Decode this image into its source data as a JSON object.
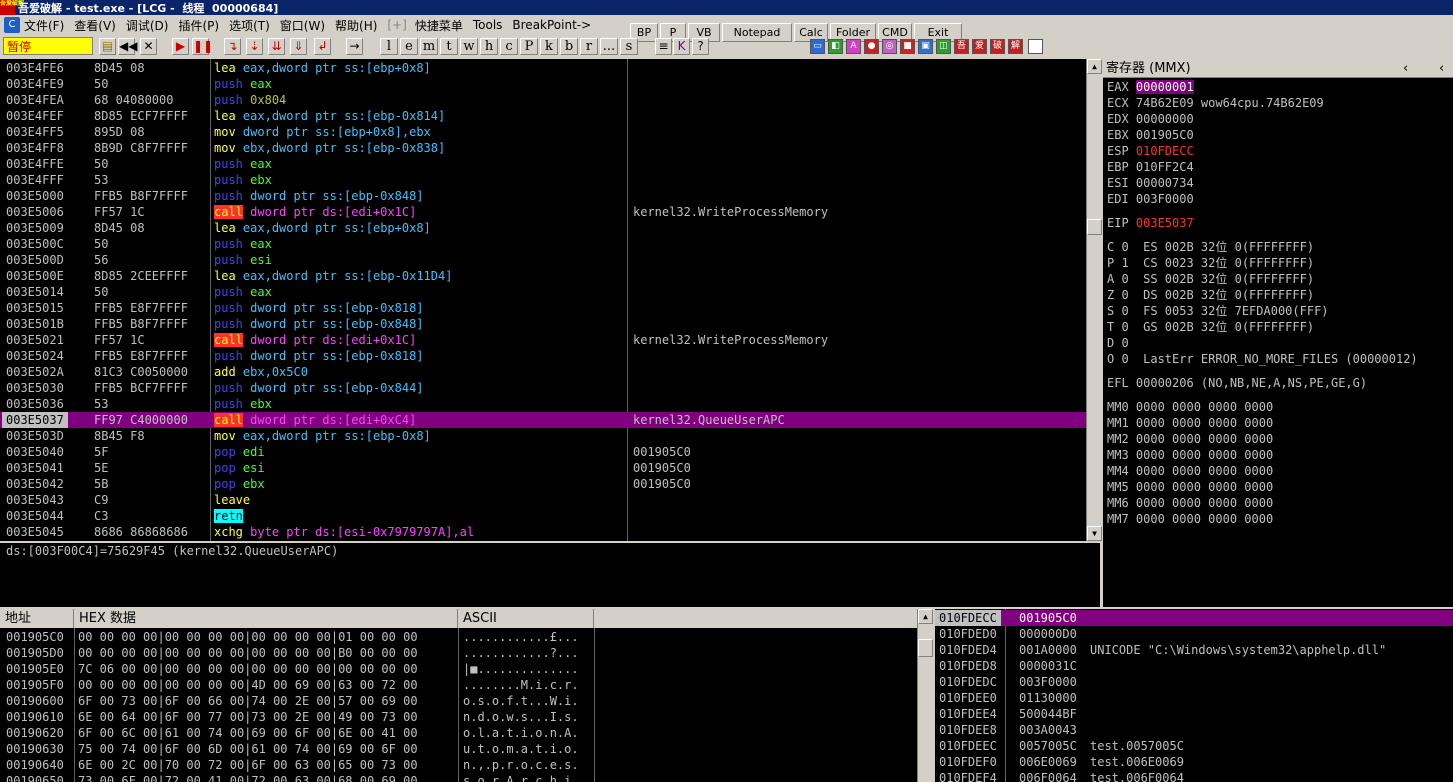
{
  "titlebar": {
    "logo_text": "吾爱破解",
    "text": "吾爱破解 - test.exe - [LCG -  线程  00000684]"
  },
  "menubar": {
    "items": [
      "文件(F)",
      "查看(V)",
      "调试(D)",
      "插件(P)",
      "选项(T)",
      "窗口(W)",
      "帮助(H)",
      "[+]",
      "快捷菜单",
      "Tools",
      "BreakPoint->"
    ]
  },
  "top_buttons": [
    "BP",
    "P",
    "VB",
    "Notepad",
    "Calc",
    "Folder",
    "CMD",
    "Exit"
  ],
  "toolbar": {
    "status_text": "暂停",
    "letter_buttons": [
      "l",
      "e",
      "m",
      "t",
      "w",
      "h",
      "c",
      "P",
      "k",
      "b",
      "r",
      "...",
      "s"
    ]
  },
  "cpu": {
    "rows": [
      {
        "addr": "003E4FE6",
        "hex": "8D45 08",
        "mn": "lea",
        "ops": "eax,dword ptr ss:[ebp+0x8]",
        "comment": ""
      },
      {
        "addr": "003E4FE9",
        "hex": "50",
        "mn": "push",
        "ops": "eax",
        "comment": ""
      },
      {
        "addr": "003E4FEA",
        "hex": "68 04080000",
        "mn": "push",
        "ops": "0x804",
        "comment": ""
      },
      {
        "addr": "003E4FEF",
        "hex": "8D85 ECF7FFFF",
        "mn": "lea",
        "ops": "eax,dword ptr ss:[ebp-0x814]",
        "comment": ""
      },
      {
        "addr": "003E4FF5",
        "hex": "895D 08",
        "mn": "mov",
        "ops": "dword ptr ss:[ebp+0x8],ebx",
        "comment": ""
      },
      {
        "addr": "003E4FF8",
        "hex": "8B9D C8F7FFFF",
        "mn": "mov",
        "ops": "ebx,dword ptr ss:[ebp-0x838]",
        "comment": ""
      },
      {
        "addr": "003E4FFE",
        "hex": "50",
        "mn": "push",
        "ops": "eax",
        "comment": ""
      },
      {
        "addr": "003E4FFF",
        "hex": "53",
        "mn": "push",
        "ops": "ebx",
        "comment": ""
      },
      {
        "addr": "003E5000",
        "hex": "FFB5 B8F7FFFF",
        "mn": "push",
        "ops": "dword ptr ss:[ebp-0x848]",
        "comment": ""
      },
      {
        "addr": "003E5006",
        "hex": "FF57 1C",
        "mn": "call",
        "ops": "dword ptr ds:[edi+0x1C]",
        "comment": "kernel32.WriteProcessMemory"
      },
      {
        "addr": "003E5009",
        "hex": "8D45 08",
        "mn": "lea",
        "ops": "eax,dword ptr ss:[ebp+0x8]",
        "comment": ""
      },
      {
        "addr": "003E500C",
        "hex": "50",
        "mn": "push",
        "ops": "eax",
        "comment": ""
      },
      {
        "addr": "003E500D",
        "hex": "56",
        "mn": "push",
        "ops": "esi",
        "comment": ""
      },
      {
        "addr": "003E500E",
        "hex": "8D85 2CEEFFFF",
        "mn": "lea",
        "ops": "eax,dword ptr ss:[ebp-0x11D4]",
        "comment": ""
      },
      {
        "addr": "003E5014",
        "hex": "50",
        "mn": "push",
        "ops": "eax",
        "comment": ""
      },
      {
        "addr": "003E5015",
        "hex": "FFB5 E8F7FFFF",
        "mn": "push",
        "ops": "dword ptr ss:[ebp-0x818]",
        "comment": ""
      },
      {
        "addr": "003E501B",
        "hex": "FFB5 B8F7FFFF",
        "mn": "push",
        "ops": "dword ptr ss:[ebp-0x848]",
        "comment": ""
      },
      {
        "addr": "003E5021",
        "hex": "FF57 1C",
        "mn": "call",
        "ops": "dword ptr ds:[edi+0x1C]",
        "comment": "kernel32.WriteProcessMemory"
      },
      {
        "addr": "003E5024",
        "hex": "FFB5 E8F7FFFF",
        "mn": "push",
        "ops": "dword ptr ss:[ebp-0x818]",
        "comment": ""
      },
      {
        "addr": "003E502A",
        "hex": "81C3 C0050000",
        "mn": "add",
        "ops": "ebx,0x5C0",
        "comment": ""
      },
      {
        "addr": "003E5030",
        "hex": "FFB5 BCF7FFFF",
        "mn": "push",
        "ops": "dword ptr ss:[ebp-0x844]",
        "comment": ""
      },
      {
        "addr": "003E5036",
        "hex": "53",
        "mn": "push",
        "ops": "ebx",
        "comment": ""
      },
      {
        "addr": "003E5037",
        "hex": "FF97 C4000000",
        "mn": "call",
        "ops": "dword ptr ds:[edi+0xC4]",
        "comment": "kernel32.QueueUserAPC",
        "selected": true
      },
      {
        "addr": "003E503D",
        "hex": "8B45 F8",
        "mn": "mov",
        "ops": "eax,dword ptr ss:[ebp-0x8]",
        "comment": ""
      },
      {
        "addr": "003E5040",
        "hex": "5F",
        "mn": "pop",
        "ops": "edi",
        "comment": "001905C0"
      },
      {
        "addr": "003E5041",
        "hex": "5E",
        "mn": "pop",
        "ops": "esi",
        "comment": "001905C0"
      },
      {
        "addr": "003E5042",
        "hex": "5B",
        "mn": "pop",
        "ops": "ebx",
        "comment": "001905C0"
      },
      {
        "addr": "003E5043",
        "hex": "C9",
        "mn": "leave",
        "ops": "",
        "comment": ""
      },
      {
        "addr": "003E5044",
        "hex": "C3",
        "mn": "retn",
        "ops": "",
        "comment": ""
      },
      {
        "addr": "003E5045",
        "hex": "8686 86868686",
        "mn": "xchg",
        "ops": "byte ptr ds:[esi-0x7979797A],al",
        "comment": ""
      }
    ]
  },
  "info_text": "ds:[003F00C4]=75629F45 (kernel32.QueueUserAPC)",
  "registers": {
    "title": "寄存器 (MMX)",
    "lines": [
      {
        "text": "EAX ",
        "val": "00000001",
        "style": "hi",
        "rest": ""
      },
      {
        "text": "ECX ",
        "val": "74B62E09",
        "style": "",
        "rest": " wow64cpu.74B62E09"
      },
      {
        "text": "EDX ",
        "val": "00000000",
        "style": "",
        "rest": ""
      },
      {
        "text": "EBX ",
        "val": "001905C0",
        "style": "",
        "rest": ""
      },
      {
        "text": "ESP ",
        "val": "010FDECC",
        "style": "red",
        "rest": ""
      },
      {
        "text": "EBP ",
        "val": "010FF2C4",
        "style": "",
        "rest": ""
      },
      {
        "text": "ESI ",
        "val": "00000734",
        "style": "",
        "rest": ""
      },
      {
        "text": "EDI ",
        "val": "003F0000",
        "style": "",
        "rest": ""
      },
      {
        "text": "EIP ",
        "val": "003E5037",
        "style": "red",
        "rest": ""
      },
      {
        "text": "C 0  ES 002B 32位 0(FFFFFFFF)",
        "val": "",
        "style": "",
        "rest": ""
      },
      {
        "text": "P 1  CS 0023 32位 0(FFFFFFFF)",
        "val": "",
        "style": "",
        "rest": ""
      },
      {
        "text": "A 0  SS 002B 32位 0(FFFFFFFF)",
        "val": "",
        "style": "",
        "rest": ""
      },
      {
        "text": "Z 0  DS 002B 32位 0(FFFFFFFF)",
        "val": "",
        "style": "",
        "rest": ""
      },
      {
        "text": "S 0  FS 0053 32位 7EFDA000(FFF)",
        "val": "",
        "style": "",
        "rest": ""
      },
      {
        "text": "T 0  GS 002B 32位 0(FFFFFFFF)",
        "val": "",
        "style": "",
        "rest": ""
      },
      {
        "text": "D 0",
        "val": "",
        "style": "",
        "rest": ""
      },
      {
        "text": "O 0  LastErr ERROR_NO_MORE_FILES (00000012)",
        "val": "",
        "style": "",
        "rest": ""
      },
      {
        "text": "EFL 00000206 (NO,NB,NE,A,NS,PE,GE,G)",
        "val": "",
        "style": "",
        "rest": ""
      },
      {
        "text": "MM0 0000 0000 0000 0000",
        "val": "",
        "style": "",
        "rest": ""
      },
      {
        "text": "MM1 0000 0000 0000 0000",
        "val": "",
        "style": "",
        "rest": ""
      },
      {
        "text": "MM2 0000 0000 0000 0000",
        "val": "",
        "style": "",
        "rest": ""
      },
      {
        "text": "MM3 0000 0000 0000 0000",
        "val": "",
        "style": "",
        "rest": ""
      },
      {
        "text": "MM4 0000 0000 0000 0000",
        "val": "",
        "style": "",
        "rest": ""
      },
      {
        "text": "MM5 0000 0000 0000 0000",
        "val": "",
        "style": "",
        "rest": ""
      },
      {
        "text": "MM6 0000 0000 0000 0000",
        "val": "",
        "style": "",
        "rest": ""
      },
      {
        "text": "MM7 0000 0000 0000 0000",
        "val": "",
        "style": "",
        "rest": ""
      }
    ]
  },
  "dump": {
    "headers": [
      "地址",
      "HEX 数据",
      "ASCII"
    ],
    "rows": [
      {
        "addr": "001905C0",
        "hex": "00 00 00 00|00 00 00 00|00 00 00 00|01 00 00 00",
        "ascii": "............£..."
      },
      {
        "addr": "001905D0",
        "hex": "00 00 00 00|00 00 00 00|00 00 00 00|B0 00 00 00",
        "ascii": "............?..."
      },
      {
        "addr": "001905E0",
        "hex": "7C 06 00 00|00 00 00 00|00 00 00 00|00 00 00 00",
        "ascii": "|■.............."
      },
      {
        "addr": "001905F0",
        "hex": "00 00 00 00|00 00 00 00|4D 00 69 00|63 00 72 00",
        "ascii": "........M.i.c.r."
      },
      {
        "addr": "00190600",
        "hex": "6F 00 73 00|6F 00 66 00|74 00 2E 00|57 00 69 00",
        "ascii": "o.s.o.f.t...W.i."
      },
      {
        "addr": "00190610",
        "hex": "6E 00 64 00|6F 00 77 00|73 00 2E 00|49 00 73 00",
        "ascii": "n.d.o.w.s...I.s."
      },
      {
        "addr": "00190620",
        "hex": "6F 00 6C 00|61 00 74 00|69 00 6F 00|6E 00 41 00",
        "ascii": "o.l.a.t.i.o.n.A."
      },
      {
        "addr": "00190630",
        "hex": "75 00 74 00|6F 00 6D 00|61 00 74 00|69 00 6F 00",
        "ascii": "u.t.o.m.a.t.i.o."
      },
      {
        "addr": "00190640",
        "hex": "6E 00 2C 00|70 00 72 00|6F 00 63 00|65 00 73 00",
        "ascii": "n.,.p.r.o.c.e.s."
      },
      {
        "addr": "00190650",
        "hex": "73 00 6F 00|72 00 41 00|72 00 63 00|68 00 69 00",
        "ascii": "s.o.r.A.r.c.h.i."
      }
    ]
  },
  "stack": {
    "rows": [
      {
        "addr": "010FDECC",
        "val": "001905C0",
        "comment": "",
        "selected": true
      },
      {
        "addr": "010FDED0",
        "val": "000000D0",
        "comment": ""
      },
      {
        "addr": "010FDED4",
        "val": "001A0000",
        "comment": "UNICODE \"C:\\Windows\\system32\\apphelp.dll\""
      },
      {
        "addr": "010FDED8",
        "val": "0000031C",
        "comment": ""
      },
      {
        "addr": "010FDEDC",
        "val": "003F0000",
        "comment": ""
      },
      {
        "addr": "010FDEE0",
        "val": "01130000",
        "comment": ""
      },
      {
        "addr": "010FDEE4",
        "val": "500044BF",
        "comment": ""
      },
      {
        "addr": "010FDEE8",
        "val": "003A0043",
        "comment": ""
      },
      {
        "addr": "010FDEEC",
        "val": "0057005C",
        "comment": "test.0057005C"
      },
      {
        "addr": "010FDEF0",
        "val": "006E0069",
        "comment": "test.006E0069"
      },
      {
        "addr": "010FDEF4",
        "val": "006F0064",
        "comment": "test.006F0064"
      }
    ]
  }
}
